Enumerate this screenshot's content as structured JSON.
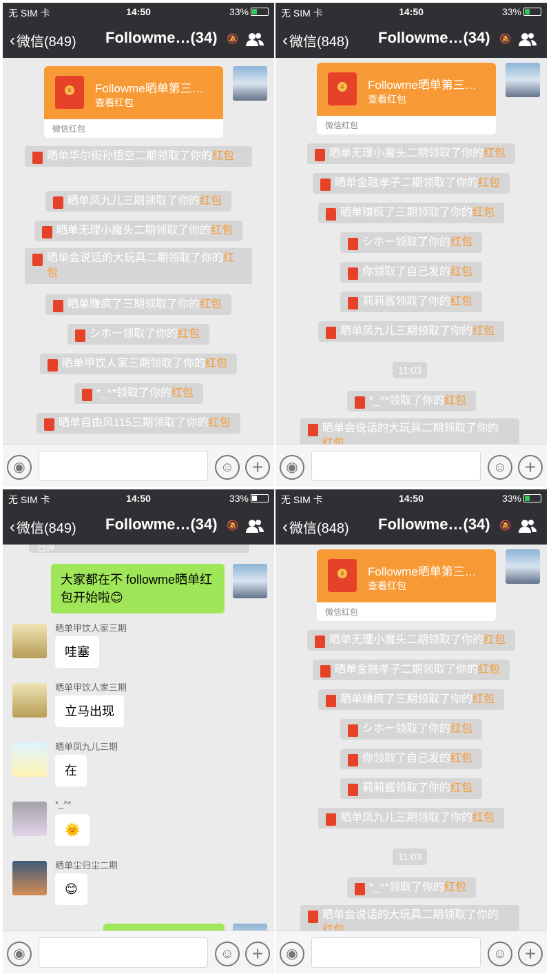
{
  "status": {
    "carrier": "无 SIM 卡",
    "time": "14:50",
    "battery": "33%",
    "battery_fraction": 0.33
  },
  "navbars": [
    {
      "back_label": "微信(849)",
      "title": "Followme…(34)"
    },
    {
      "back_label": "微信(848)",
      "title": "Followme…(34)"
    },
    {
      "back_label": "微信(849)",
      "title": "Followme…(34)"
    },
    {
      "back_label": "微信(848)",
      "title": "Followme…(34)"
    }
  ],
  "red_packet": {
    "title": "Followme晒单第三…",
    "sub": "查看红包",
    "footer": "微信红包"
  },
  "hongbao_word": "红包",
  "panel1_notices": [
    "晒单华尔街孙悟空二期领取了你的",
    "晒单凤九儿三期领取了你的",
    "晒单无理小魔头二期领取了你的",
    "晒单会说话的大玩具二期领取了你的",
    "晒单赚疯了三期领取了你的",
    "シホー领取了你的",
    "晒单甲饮人家三期领取了你的",
    "*_^*领取了你的",
    "晒单自由风115三期领取了你的"
  ],
  "panel2_notices": [
    "晒单无理小魔头二期领取了你的",
    "晒单金融孝子二期领取了你的",
    "晒单赚疯了三期领取了你的",
    "シホー领取了你的",
    "你领取了自己发的",
    "莉莉酱领取了你的",
    "晒单凤九儿三期领取了你的"
  ],
  "time_chip": "11:03",
  "panel2_after": [
    "*_^*领取了你的",
    "晒单会说话的大玩具二期领取了你"
  ],
  "panel2_last_tail": "的",
  "panel3": {
    "my_message": "大家都在不 followme晒单红包开始啦",
    "my_emoji": "😊",
    "messages": [
      {
        "nick": "晒单甲饮人家三期",
        "text": "哇塞"
      },
      {
        "nick": "晒单甲饮人家三期",
        "text": "立马出现"
      },
      {
        "nick": "晒单凤九儿三期",
        "text": "在"
      },
      {
        "nick": "*_^*",
        "text": "🌞"
      },
      {
        "nick": "晒单尘归尘二期",
        "text": "😊"
      }
    ]
  },
  "cut_text": "已评"
}
